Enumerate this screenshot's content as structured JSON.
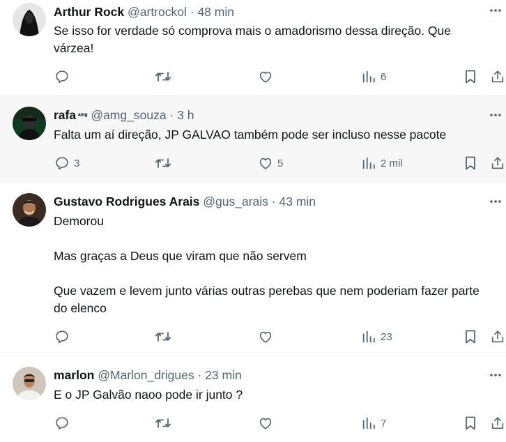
{
  "posts": [
    {
      "name": "Arthur Rock",
      "handle": "@artrockol",
      "time": "48 min",
      "badge": "",
      "text": "Se isso for verdade só comprova mais o amadorismo dessa direção. Que várzea!",
      "replies": "",
      "reposts": "",
      "likes": "",
      "views": "6",
      "avatar_color": "#1d1d1d"
    },
    {
      "name": "rafa",
      "handle": "@amg_souza",
      "time": "3 h",
      "badge": "ᵃᵐᵍ",
      "text": "Falta um aí direção, JP GALVAO também pode ser incluso nesse pacote",
      "replies": "3",
      "reposts": "",
      "likes": "5",
      "views": "2 mil",
      "avatar_color": "#0e3a20"
    },
    {
      "name": "Gustavo Rodrigues Arais",
      "handle": "@gus_arais",
      "time": "43 min",
      "badge": "",
      "text": "Demorou\n\nMas graças a Deus que viram que não servem\n\nQue vazem e levem junto várias outras perebas que nem poderiam fazer parte do elenco",
      "replies": "",
      "reposts": "",
      "likes": "",
      "views": "23",
      "avatar_color": "#3a2c22"
    },
    {
      "name": "marlon",
      "handle": "@Marlon_drigues",
      "time": "23 min",
      "badge": "",
      "text": "E o JP Galvão naoo pode ir junto ?",
      "replies": "",
      "reposts": "",
      "likes": "",
      "views": "7",
      "avatar_color": "#cfc7bd"
    }
  ],
  "separator": "·",
  "icons": {
    "reply": "reply-icon",
    "repost": "repost-icon",
    "like": "heart-icon",
    "views": "views-icon",
    "bookmark": "bookmark-icon",
    "share": "share-icon",
    "more": "more-icon"
  },
  "colors": {
    "text": "#0f1419",
    "secondary": "#536471",
    "divider": "#eff3f4",
    "hover_background": "#f7f7f7"
  }
}
